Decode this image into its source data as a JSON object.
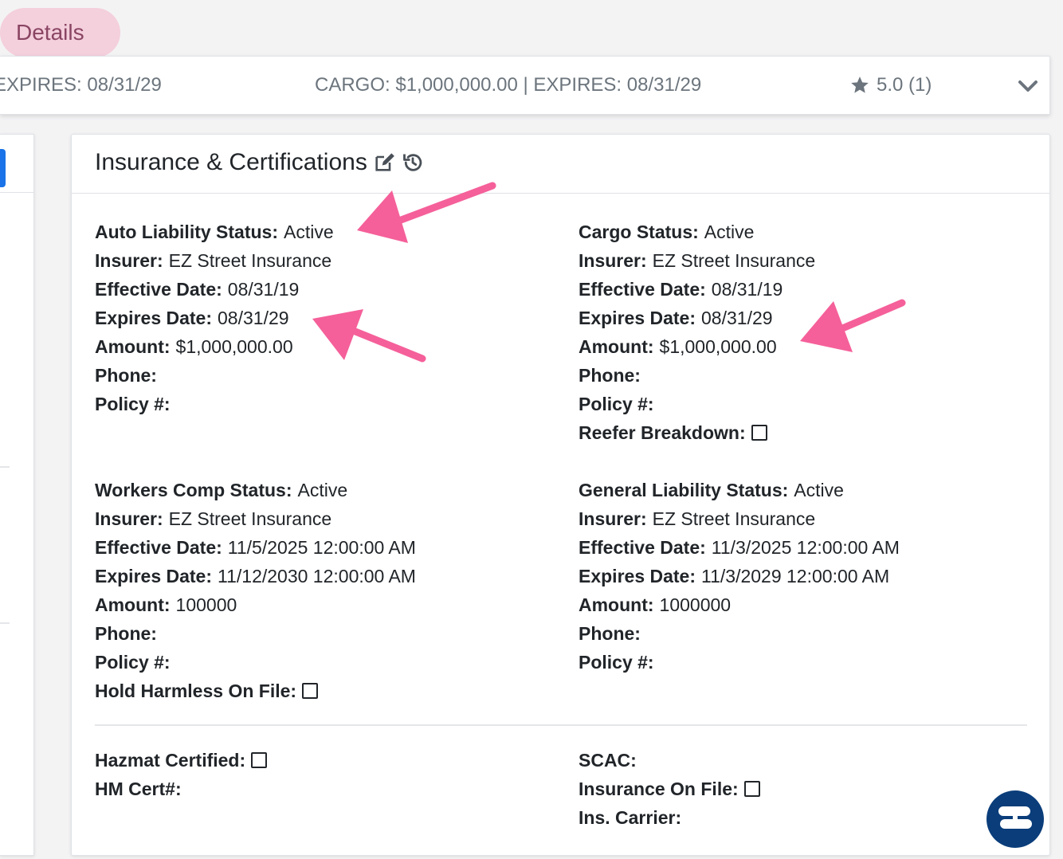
{
  "tab": {
    "label": "Details"
  },
  "summary": {
    "left_text": "EXPIRES: 08/31/29",
    "cargo_text": "CARGO: $1,000,000.00 | EXPIRES: 08/31/29",
    "rating_text": "5.0 (1)"
  },
  "card": {
    "title": "Insurance & Certifications"
  },
  "auto": {
    "status_label": "Auto Liability Status:",
    "status_value": "Active",
    "insurer_label": "Insurer:",
    "insurer_value": "EZ Street Insurance",
    "effective_label": "Effective Date:",
    "effective_value": "08/31/19",
    "expires_label": "Expires Date:",
    "expires_value": "08/31/29",
    "amount_label": "Amount:",
    "amount_value": "$1,000,000.00",
    "phone_label": "Phone:",
    "policy_label": "Policy #:"
  },
  "cargo": {
    "status_label": "Cargo Status:",
    "status_value": "Active",
    "insurer_label": "Insurer:",
    "insurer_value": "EZ Street Insurance",
    "effective_label": "Effective Date:",
    "effective_value": "08/31/19",
    "expires_label": "Expires Date:",
    "expires_value": "08/31/29",
    "amount_label": "Amount:",
    "amount_value": "$1,000,000.00",
    "phone_label": "Phone:",
    "policy_label": "Policy #:",
    "reefer_label": "Reefer Breakdown:"
  },
  "workers": {
    "status_label": "Workers Comp Status:",
    "status_value": "Active",
    "insurer_label": "Insurer:",
    "insurer_value": "EZ Street Insurance",
    "effective_label": "Effective Date:",
    "effective_value": "11/5/2025 12:00:00 AM",
    "expires_label": "Expires Date:",
    "expires_value": "11/12/2030 12:00:00 AM",
    "amount_label": "Amount:",
    "amount_value": "100000",
    "phone_label": "Phone:",
    "policy_label": "Policy #:",
    "hold_label": "Hold Harmless On File:"
  },
  "general": {
    "status_label": "General Liability Status:",
    "status_value": "Active",
    "insurer_label": "Insurer:",
    "insurer_value": "EZ Street Insurance",
    "effective_label": "Effective Date:",
    "effective_value": "11/3/2025 12:00:00 AM",
    "expires_label": "Expires Date:",
    "expires_value": "11/3/2029 12:00:00 AM",
    "amount_label": "Amount:",
    "amount_value": "1000000",
    "phone_label": "Phone:",
    "policy_label": "Policy #:"
  },
  "certs": {
    "hazmat_label": "Hazmat Certified:",
    "hmcert_label": "HM Cert#:",
    "scac_label": "SCAC:",
    "ins_on_file_label": "Insurance On File:",
    "ins_carrier_label": "Ins. Carrier:"
  },
  "colors": {
    "arrow": "#f5609a",
    "tab_bg": "#f4cfdc",
    "tab_text": "#8a4563",
    "chat_bg": "#0a3d7a",
    "left_button": "#1a73e8"
  },
  "icons": {
    "edit": "edit-icon",
    "history": "history-icon",
    "star": "star-icon",
    "chevron": "chevron-down-icon",
    "chat": "signpost-icon"
  }
}
